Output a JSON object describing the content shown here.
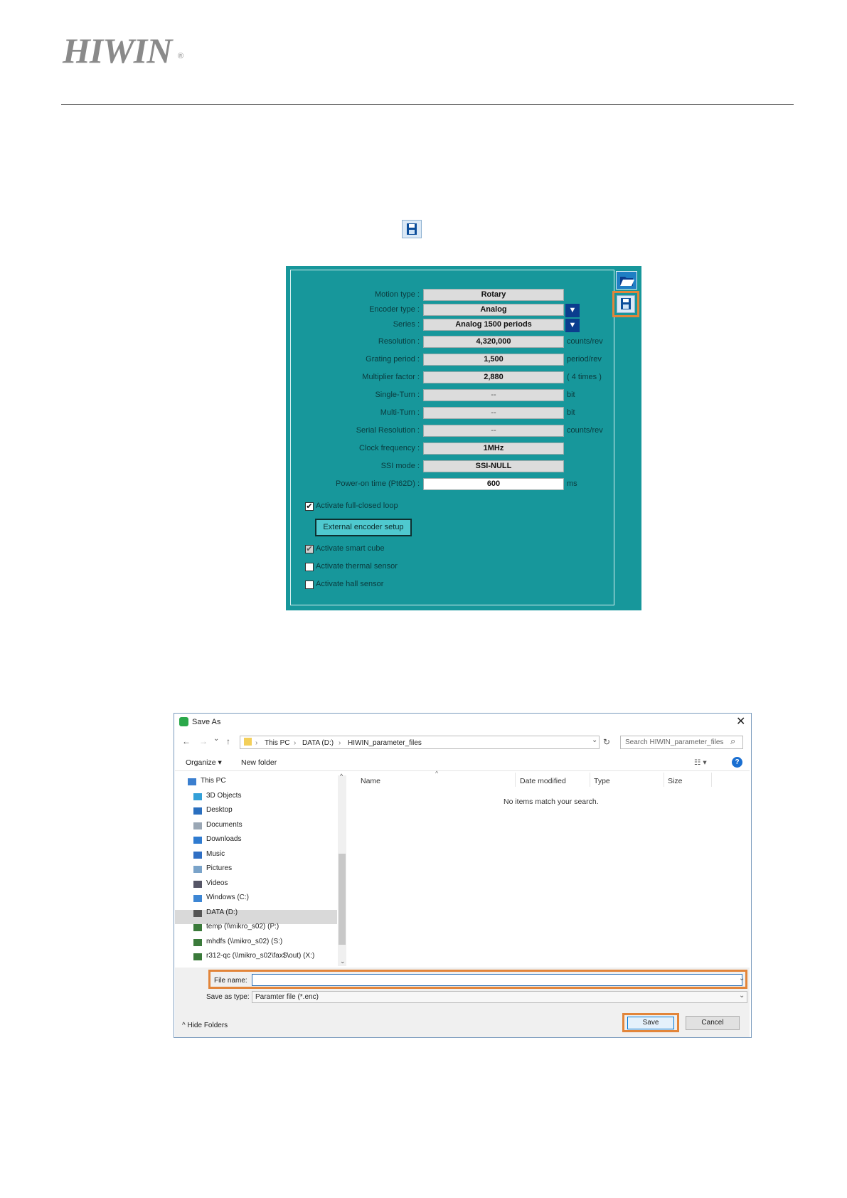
{
  "header": {
    "logo": "HIWIN",
    "registered": "®"
  },
  "panel": {
    "fields": [
      {
        "label": "Motion type :",
        "value": "Rotary",
        "unit": ""
      },
      {
        "label": "Encoder type :",
        "value": "Analog",
        "unit": ""
      },
      {
        "label": "Series :",
        "value": "Analog 1500 periods",
        "unit": ""
      },
      {
        "label": "Resolution :",
        "value": "4,320,000",
        "unit": "counts/rev"
      },
      {
        "label": "Grating period :",
        "value": "1,500",
        "unit": "period/rev"
      },
      {
        "label": "Multiplier factor :",
        "value": "2,880",
        "unit": "( 4 times )"
      },
      {
        "label": "Single-Turn :",
        "value": "--",
        "unit": "bit"
      },
      {
        "label": "Multi-Turn :",
        "value": "--",
        "unit": "bit"
      },
      {
        "label": "Serial Resolution :",
        "value": "--",
        "unit": "counts/rev"
      },
      {
        "label": "Clock frequency :",
        "value": "1MHz",
        "unit": ""
      },
      {
        "label": "SSI mode :",
        "value": "SSI-NULL",
        "unit": ""
      },
      {
        "label": "Power-on time (Pt62D) :",
        "value": "600",
        "unit": "ms"
      }
    ],
    "dropdown_arrow": "▼",
    "checkboxes": [
      {
        "label": "Activate full-closed loop",
        "checked": true
      },
      {
        "label": "Activate smart cube",
        "checked": true
      },
      {
        "label": "Activate thermal sensor",
        "checked": false
      },
      {
        "label": "Activate hall sensor",
        "checked": false
      }
    ],
    "external_button": "External encoder setup",
    "check_mark": "✔"
  },
  "dialog": {
    "title": "Save As",
    "close": "✕",
    "back": "←",
    "forward": "→",
    "recent": "⌄",
    "up": "↑",
    "crumbs": [
      "This PC",
      "DATA (D:)",
      "HIWIN_parameter_files"
    ],
    "crumb_sep": "›",
    "refresh": "↻",
    "addr_dropdown": "⌄",
    "search_placeholder": "Search HIWIN_parameter_files",
    "search_icon": "⌕",
    "organize": "Organize ▾",
    "new_folder": "New folder",
    "view": "☷ ▾",
    "help": "?",
    "sort_caret": "^",
    "scroll_up": "^",
    "scroll_down": "⌄",
    "nav_items": [
      "This PC",
      "3D Objects",
      "Desktop",
      "Documents",
      "Downloads",
      "Music",
      "Pictures",
      "Videos",
      "Windows (C:)",
      "DATA (D:)",
      "temp (\\\\mikro_s02) (P:)",
      "mhdfs (\\\\mikro_s02) (S:)",
      "r312-qc (\\\\mikro_s02\\fax$\\out) (X:)"
    ],
    "columns": [
      "Name",
      "Date modified",
      "Type",
      "Size"
    ],
    "empty_text": "No items match your search.",
    "file_name_label": "File name:",
    "file_name_value": "",
    "file_name_dropdown": "⌄",
    "save_type_label": "Save as type:",
    "save_type_value": "Paramter file (*.enc)",
    "save_type_dropdown": "⌄",
    "hide_folders": "^  Hide Folders",
    "save": "Save",
    "cancel": "Cancel"
  },
  "colors": {
    "panel": "#17979b",
    "highlight": "#e2853a",
    "logo": "#8a8a8a"
  }
}
